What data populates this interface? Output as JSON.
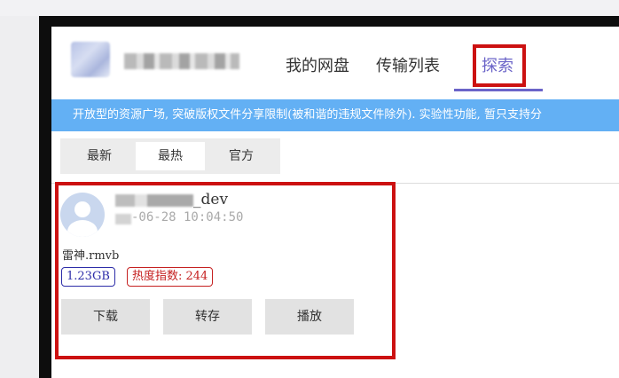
{
  "nav": {
    "my_disk": "我的网盘",
    "transfer_list": "传输列表",
    "explore": "探索"
  },
  "notice": {
    "text": "开放型的资源广场, 突破版权文件分享限制(被和谐的违规文件除外). 实验性功能, 暂只支持分"
  },
  "tabs": [
    {
      "label": "最新",
      "active": false
    },
    {
      "label": "最热",
      "active": true
    },
    {
      "label": "官方",
      "active": false
    }
  ],
  "card": {
    "user_suffix": "_dev",
    "timestamp": "-06-28 10:04:50",
    "file_name": "雷神.rmvb",
    "size_badge": "1.23GB",
    "hot_badge": "热度指数: 244",
    "actions": {
      "download": "下载",
      "save": "转存",
      "play": "播放"
    }
  },
  "colors": {
    "accent": "#6b64c8",
    "notice_bg": "#63b0f4",
    "highlight": "#cc1111"
  }
}
